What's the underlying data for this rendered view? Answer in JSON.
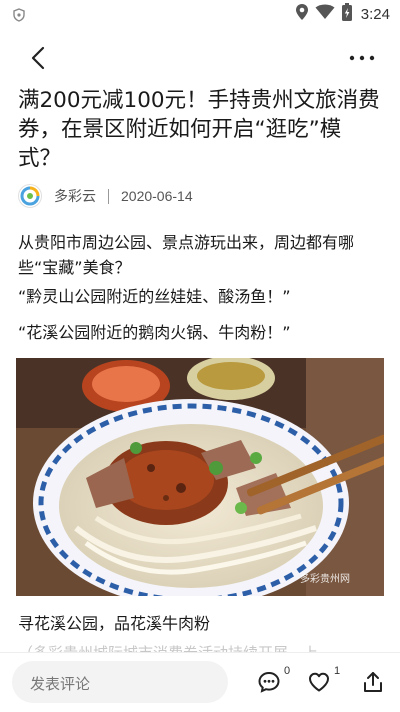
{
  "status_bar": {
    "time": "3:24",
    "icons": [
      "notification-shield-icon",
      "location-pin-icon",
      "wifi-icon",
      "battery-charging-icon"
    ]
  },
  "nav": {
    "back_icon": "chevron-left-icon",
    "more_icon": "more-horizontal-icon"
  },
  "article": {
    "title": "满200元减100元！手持贵州文旅消费券，在景区附近如何开启“逛吃”模式？",
    "author": "多彩云",
    "date": "2020-06-14",
    "paragraphs": [
      "从贵阳市周边公园、景点游玩出来，周边都有哪些“宝藏”美食？",
      "“黔灵山公园附近的丝娃娃、酸汤鱼！”",
      "“花溪公园附近的鹅肉火锅、牛肉粉！”"
    ],
    "photo_watermark": "多彩贵州网",
    "caption": "寻花溪公园，品花溪牛肉粉",
    "faded_text": "（多彩贵州城际城市消费券活动持续开展，上"
  },
  "bottom_bar": {
    "comment_placeholder": "发表评论",
    "comment_count": "0",
    "like_count": "1",
    "colors": {
      "bar_bg": "#ffffff",
      "input_bg": "#f3f3f3"
    }
  }
}
